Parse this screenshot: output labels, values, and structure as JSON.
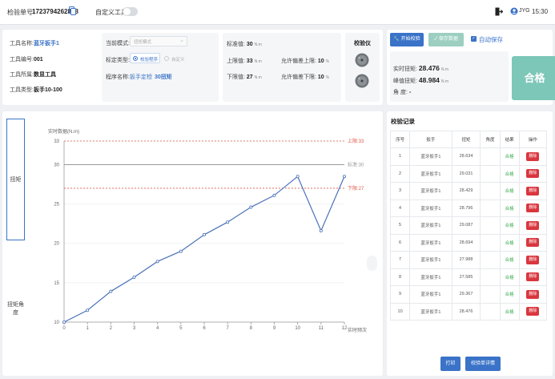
{
  "topbar": {
    "serial_label": "检验单号:",
    "serial_value": "1723794262838",
    "custom_tool_label": "自定义工具",
    "username": "JYG",
    "time": "15:30"
  },
  "tool_info": {
    "name_label": "工具名称:",
    "name_value": "蓝牙扳手1",
    "code_label": "工具编号:",
    "code_value": "001",
    "owner_label": "工具所属:",
    "owner_value": "数显工具",
    "type_label": "工具类型:",
    "type_value": "扳手10-100"
  },
  "mode_panel": {
    "current_mode_label": "当前模式:",
    "current_mode_placeholder": "扭矩模式",
    "calib_type_label": "标定类型:",
    "calib_option_1": "校验程序",
    "calib_option_2": "自定义",
    "program_label": "程序名称:",
    "program_value": "扳手定检",
    "program_value2": "30扭矩"
  },
  "standard_panel": {
    "standard_label": "标准值:",
    "standard_value": "30",
    "unit": "N.m",
    "upper_label": "上限值:",
    "upper_value": "33",
    "lower_label": "下限值:",
    "lower_value": "27",
    "dev_upper_label": "允许偏差上限:",
    "dev_upper_value": "10",
    "pct": "%",
    "dev_lower_label": "允许偏差下限:",
    "dev_lower_value": "10"
  },
  "instrument": {
    "title": "校验仪"
  },
  "actions": {
    "start_label": "开始校验",
    "save_label": "保存数据",
    "auto_save_label": "自动保存"
  },
  "readout": {
    "realtime_label": "实时扭矩:",
    "realtime_value": "28.476",
    "unit": "N.m",
    "peak_label": "峰值扭矩:",
    "peak_value": "48.984",
    "angle_label": "角    度:",
    "angle_value": "-",
    "result": "合格"
  },
  "side_tabs": {
    "torque": "扭矩",
    "torque_angle": "扭矩角度"
  },
  "chart_data": {
    "type": "line",
    "ylabel": "实时数据(N.m)",
    "xlabel": "实时频次",
    "xlim": [
      0,
      12
    ],
    "ylim": [
      10,
      33
    ],
    "x_ticks": [
      "0",
      "1",
      "2",
      "3",
      "4",
      "5",
      "6",
      "7",
      "8",
      "9",
      "10",
      "11",
      "12"
    ],
    "y_ticks": [
      "10",
      "15",
      "20",
      "25",
      "30",
      "33"
    ],
    "series": [
      {
        "values": [
          [
            0,
            10
          ],
          [
            1,
            11.5
          ],
          [
            2,
            13.9
          ],
          [
            3,
            15.7
          ],
          [
            4,
            17.7
          ],
          [
            5,
            19
          ],
          [
            6,
            21.1
          ],
          [
            7,
            22.7
          ],
          [
            8,
            24.6
          ],
          [
            9,
            26.1
          ],
          [
            10,
            28.5
          ],
          [
            11,
            21.6
          ],
          [
            12,
            28.5
          ]
        ]
      }
    ],
    "reference_lines": [
      {
        "label": "上限:33",
        "value": 33,
        "color": "#e05a4a",
        "style": "dashed"
      },
      {
        "label": "标准:30",
        "value": 30,
        "color": "#999999",
        "style": "solid"
      },
      {
        "label": "下限:27",
        "value": 27,
        "color": "#e05a4a",
        "style": "dashed"
      }
    ],
    "line_color": "#4a72b8"
  },
  "records": {
    "title": "校验记录",
    "headers": [
      "序号",
      "扳手",
      "扭矩",
      "角度",
      "结果",
      "操作"
    ],
    "rows": [
      {
        "no": "1",
        "wrench": "蓝牙扳手1",
        "torque": "28.634",
        "angle": "",
        "result": "合格",
        "op": "删除"
      },
      {
        "no": "2",
        "wrench": "蓝牙扳手1",
        "torque": "29.031",
        "angle": "",
        "result": "合格",
        "op": "删除"
      },
      {
        "no": "3",
        "wrench": "蓝牙扳手1",
        "torque": "28.429",
        "angle": "",
        "result": "合格",
        "op": "删除"
      },
      {
        "no": "4",
        "wrench": "蓝牙扳手1",
        "torque": "28.796",
        "angle": "",
        "result": "合格",
        "op": "删除"
      },
      {
        "no": "5",
        "wrench": "蓝牙扳手1",
        "torque": "29.087",
        "angle": "",
        "result": "合格",
        "op": "删除"
      },
      {
        "no": "6",
        "wrench": "蓝牙扳手1",
        "torque": "28.694",
        "angle": "",
        "result": "合格",
        "op": "删除"
      },
      {
        "no": "7",
        "wrench": "蓝牙扳手1",
        "torque": "27.988",
        "angle": "",
        "result": "合格",
        "op": "删除"
      },
      {
        "no": "8",
        "wrench": "蓝牙扳手1",
        "torque": "27.585",
        "angle": "",
        "result": "合格",
        "op": "删除"
      },
      {
        "no": "9",
        "wrench": "蓝牙扳手1",
        "torque": "29.367",
        "angle": "",
        "result": "合格",
        "op": "删除"
      },
      {
        "no": "10",
        "wrench": "蓝牙扳手1",
        "torque": "28.476",
        "angle": "",
        "result": "合格",
        "op": "删除"
      }
    ],
    "print_label": "打印",
    "detail_label": "校验单详情"
  },
  "colors": {
    "primary": "#3a73c8",
    "pass": "#7dc7b8",
    "danger": "#d9363e",
    "ok_text": "#3aaa50"
  }
}
